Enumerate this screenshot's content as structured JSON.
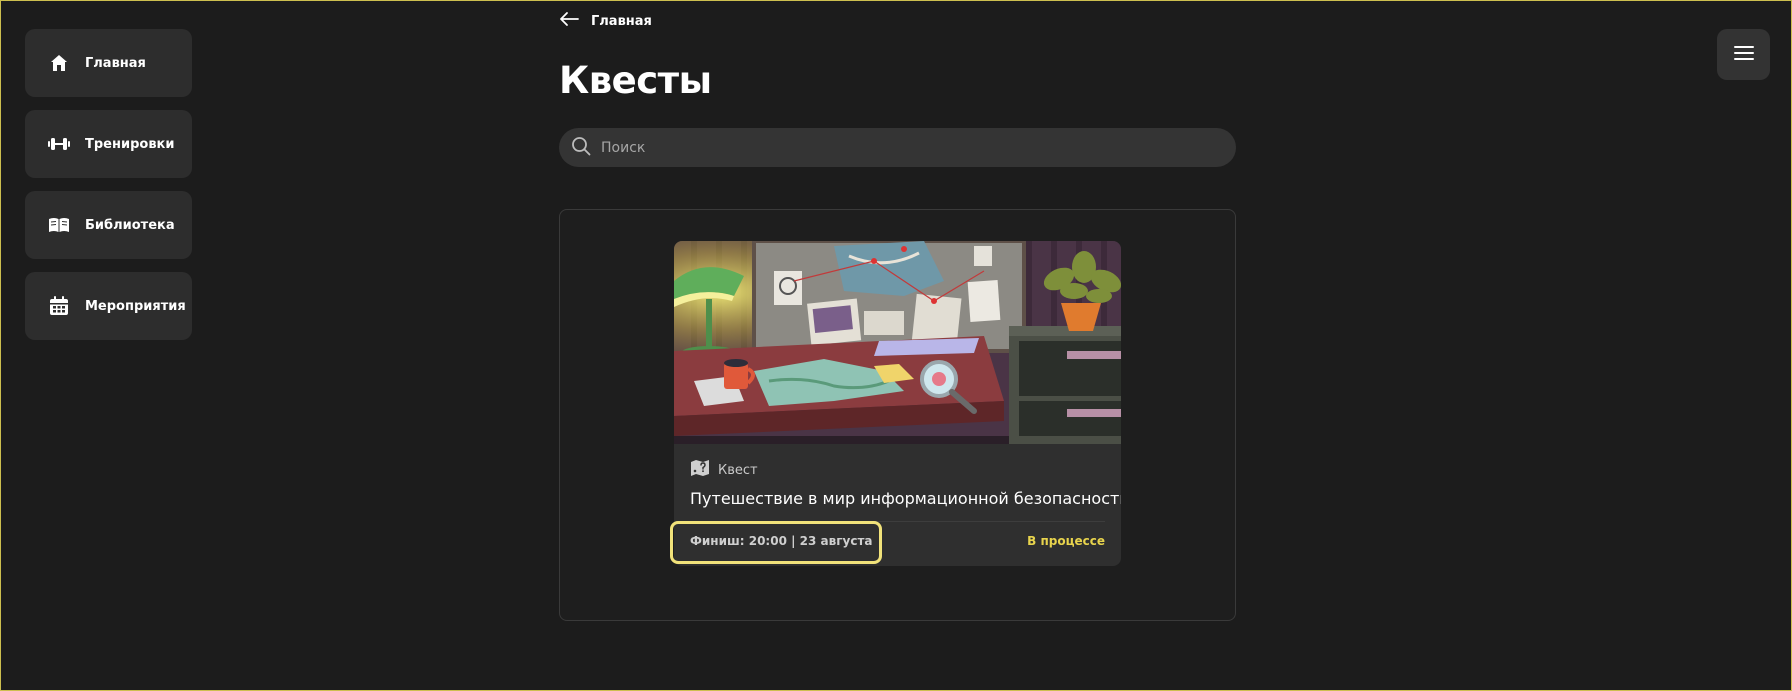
{
  "sidebar": {
    "items": [
      {
        "label": "Главная",
        "icon": "home-icon"
      },
      {
        "label": "Тренировки",
        "icon": "dumbbell-icon"
      },
      {
        "label": "Библиотека",
        "icon": "book-icon"
      },
      {
        "label": "Мероприятия",
        "icon": "calendar-icon"
      }
    ]
  },
  "header": {
    "back_label": "Главная",
    "title": "Квесты",
    "menu_icon": "hamburger-icon"
  },
  "search": {
    "placeholder": "Поиск"
  },
  "quests": [
    {
      "type": "Квест",
      "type_icon": "quest-map-icon",
      "title": "Путешествие в мир информационной безопасности",
      "finish": "Финиш: 20:00 | 23 августа",
      "status": "В процессе"
    }
  ],
  "colors": {
    "background": "#1c1c1c",
    "surface": "#2d2d2d",
    "accent": "#e8d44d",
    "highlight": "#f1e27a"
  }
}
